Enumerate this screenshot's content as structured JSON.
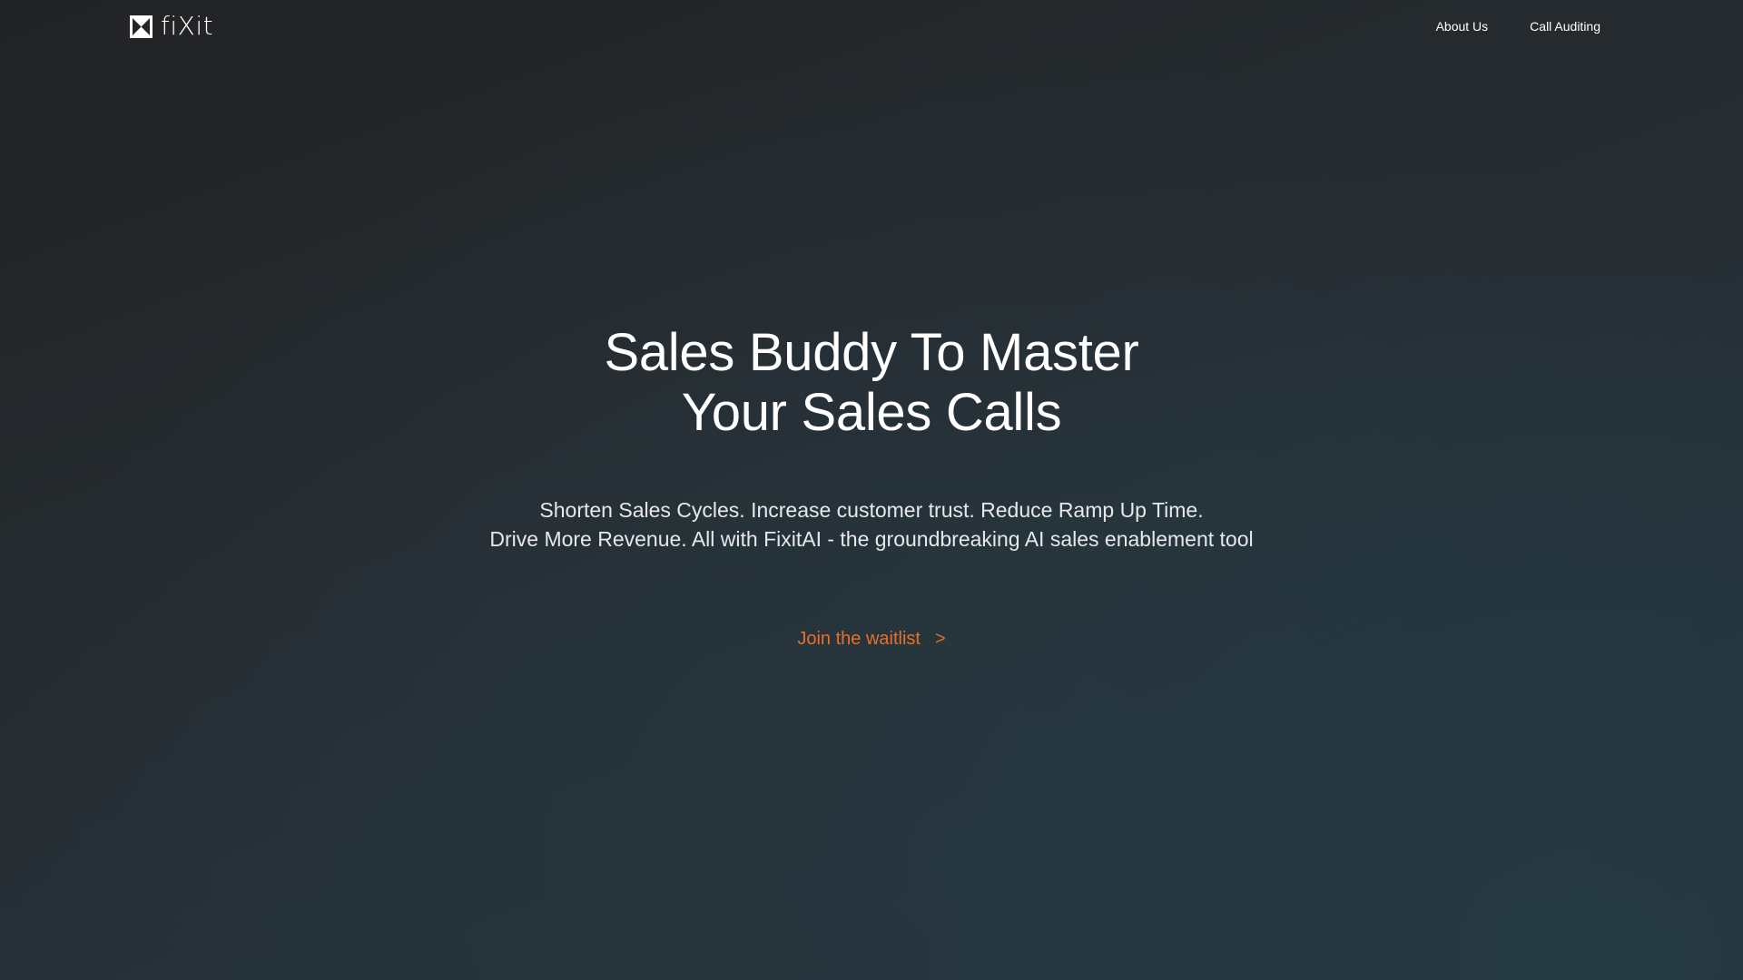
{
  "header": {
    "brand_name": "fiXit",
    "logo_icon": "fixit-logo-icon",
    "nav": [
      {
        "label": "About Us"
      },
      {
        "label": "Call Auditing"
      }
    ]
  },
  "hero": {
    "title_line1": "Sales Buddy To Master",
    "title_line2": "Your Sales Calls",
    "subtitle_line1": "Shorten Sales Cycles. Increase customer trust. Reduce Ramp Up Time.",
    "subtitle_line2": "Drive More Revenue. All with FixitAI - the groundbreaking AI sales enablement tool",
    "cta_label": "Join the waitlist",
    "cta_arrow": ">"
  },
  "colors": {
    "accent": "#e8702a",
    "background_dark": "#212325",
    "background_teal": "#27343d",
    "text": "#ffffff"
  }
}
